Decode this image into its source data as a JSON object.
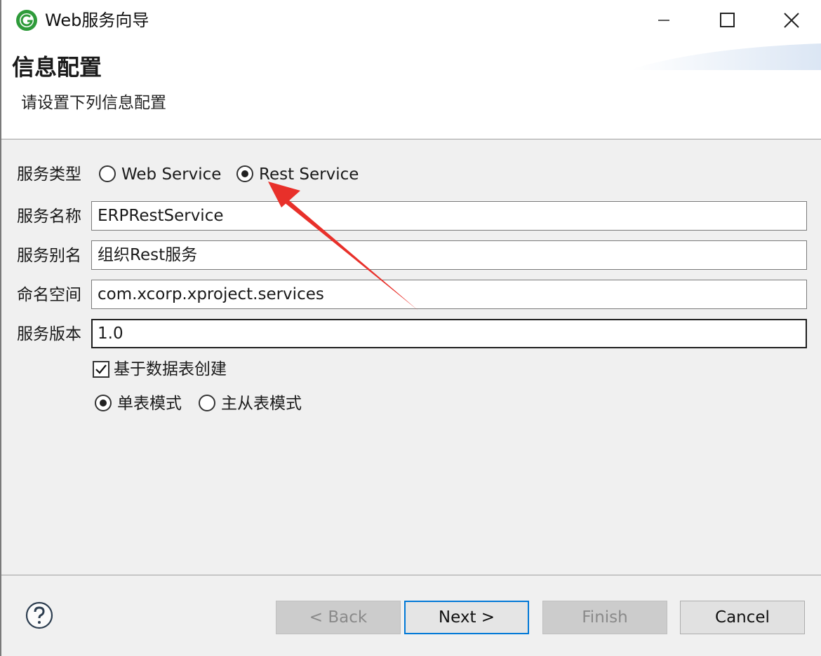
{
  "window": {
    "title": "Web服务向导"
  },
  "header": {
    "title": "信息配置",
    "description": "请设置下列信息配置"
  },
  "form": {
    "service_type": {
      "label": "服务类型",
      "options": [
        {
          "label": "Web Service",
          "selected": false
        },
        {
          "label": "Rest Service",
          "selected": true
        }
      ]
    },
    "service_name": {
      "label": "服务名称",
      "value": "ERPRestService"
    },
    "service_alias": {
      "label": "服务别名",
      "value": "组织Rest服务"
    },
    "namespace": {
      "label": "命名空间",
      "value": "com.xcorp.xproject.services"
    },
    "service_version": {
      "label": "服务版本",
      "value": "1.0"
    },
    "create_from_table": {
      "label": "基于数据表创建",
      "checked": true
    },
    "table_mode": {
      "options": [
        {
          "label": "单表模式",
          "selected": true
        },
        {
          "label": "主从表模式",
          "selected": false
        }
      ]
    }
  },
  "buttons": {
    "back": "< Back",
    "next": "Next >",
    "finish": "Finish",
    "cancel": "Cancel"
  },
  "icons": {
    "app": "app-logo-icon",
    "help": "help-icon",
    "minimize": "minimize-icon",
    "maximize": "maximize-icon",
    "close": "close-icon"
  },
  "colors": {
    "accent": "#0078d7",
    "annotation_arrow": "#e8302a",
    "app_icon": "#2e9b3a"
  }
}
